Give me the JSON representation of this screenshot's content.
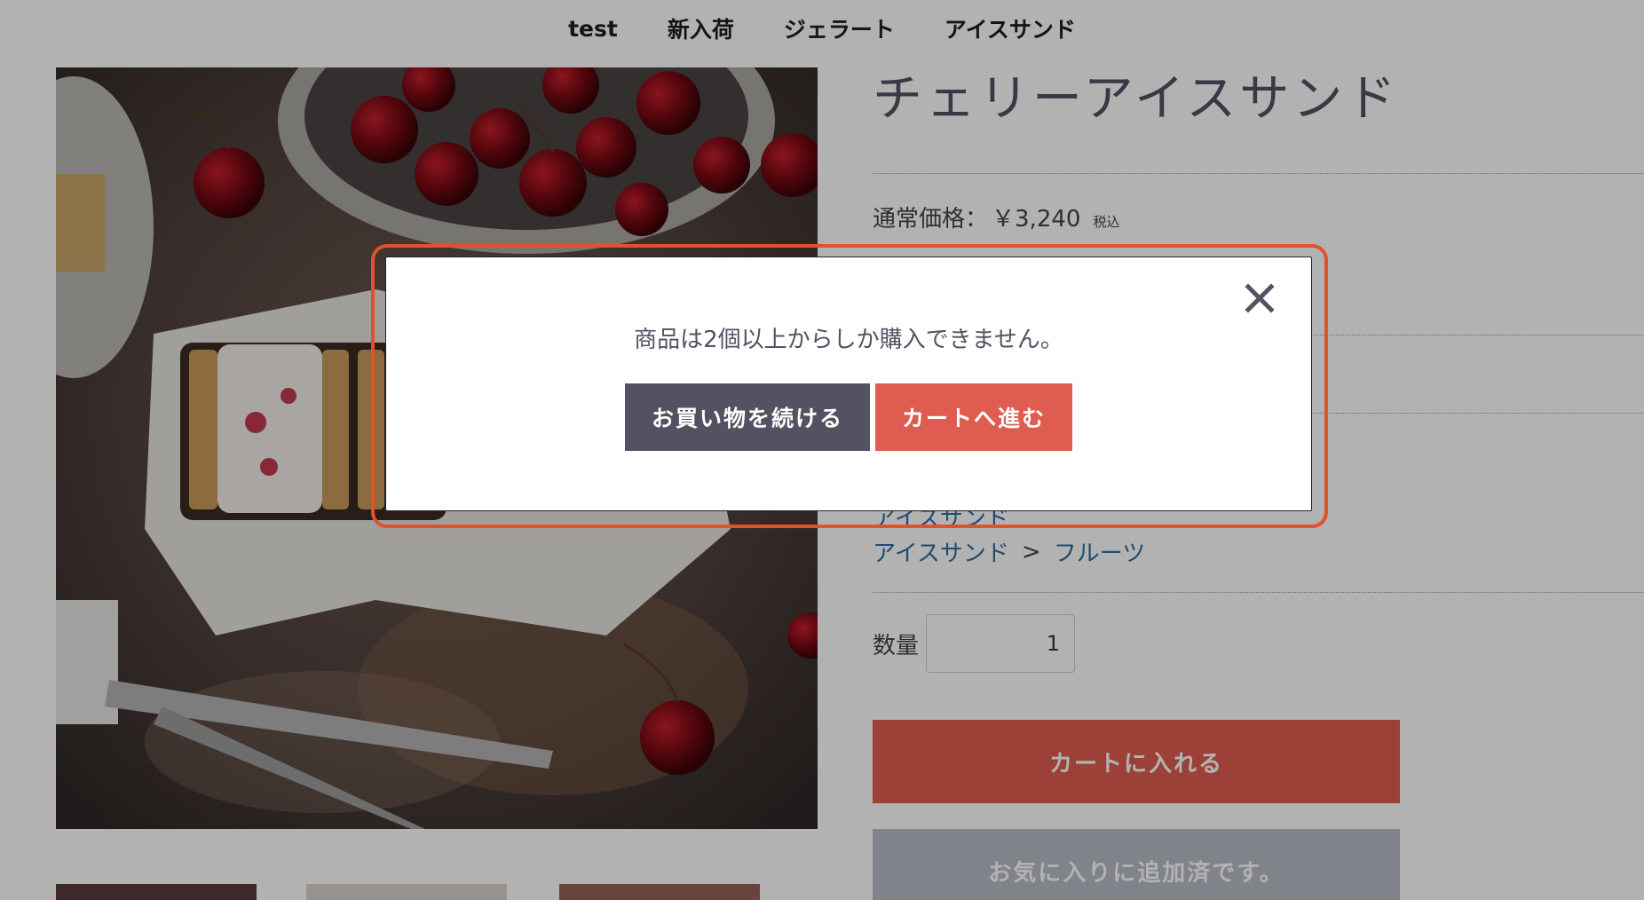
{
  "nav": {
    "items": [
      {
        "label": "test"
      },
      {
        "label": "新入荷"
      },
      {
        "label": "ジェラート"
      },
      {
        "label": "アイスサンド"
      }
    ]
  },
  "product": {
    "title": "チェリーアイスサンド",
    "price_label": "通常価格：",
    "price": "￥3,240",
    "tax_label": "税込",
    "categories": [
      {
        "label": "アイスサンド"
      },
      {
        "parent": "アイスサンド",
        "separator": ">",
        "child": "フルーツ"
      }
    ],
    "quantity_label": "数量",
    "quantity_value": "1",
    "add_to_cart": "カートに入れる",
    "favorite": "お気に入りに追加済です。"
  },
  "modal": {
    "message": "商品は2個以上からしか購入できません。",
    "continue_label": "お買い物を続ける",
    "to_cart_label": "カートへ進む"
  },
  "colors": {
    "accent": "#de5d50",
    "primary_dark": "#525263",
    "highlight_border": "#e0522b",
    "link": "#2e6ea3"
  }
}
